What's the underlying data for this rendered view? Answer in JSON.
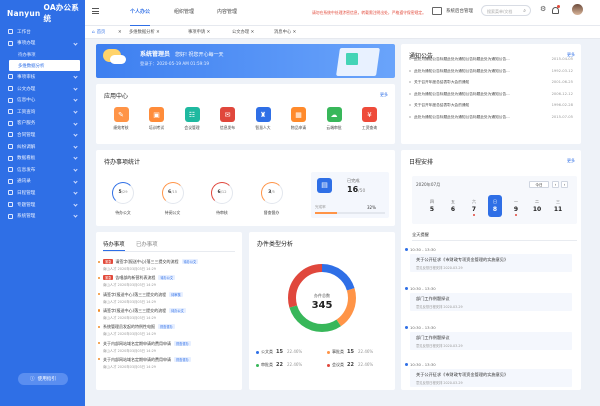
{
  "app": {
    "logo": "Nanyun",
    "title": "OA办公系统"
  },
  "colors": {
    "primary": "#2f6fe6",
    "sidebar": "#2f6fe6",
    "alert": "#e24a3b"
  },
  "sidebar": {
    "items": [
      {
        "icon": "home-icon",
        "label": "工作台"
      },
      {
        "icon": "briefcase-icon",
        "label": "事项办理",
        "expanded": true
      },
      {
        "icon": "user-icon",
        "label": "事项审核"
      },
      {
        "icon": "document-icon",
        "label": "公文办理"
      },
      {
        "icon": "message-icon",
        "label": "信息中心"
      },
      {
        "icon": "box-icon",
        "label": "工资查询"
      },
      {
        "icon": "people-icon",
        "label": "客户服务"
      },
      {
        "icon": "stack-icon",
        "label": "合同管理"
      },
      {
        "icon": "shield-icon",
        "label": "纠纷调解"
      },
      {
        "icon": "chart-icon",
        "label": "数据看板"
      },
      {
        "icon": "doc2-icon",
        "label": "信息发布"
      },
      {
        "icon": "mail-icon",
        "label": "通讯录"
      },
      {
        "icon": "calendar-icon",
        "label": "日程管理"
      },
      {
        "icon": "folder-icon",
        "label": "专题管理"
      },
      {
        "icon": "settings-icon",
        "label": "系统管理"
      }
    ],
    "sub_items": [
      "待办事项",
      "多维数据分析"
    ],
    "bottom_button": "使用指引"
  },
  "topbar": {
    "nav": [
      "个人办公",
      "组织管理",
      "内容管理"
    ],
    "notice": "请勿在系统中处理涉密信息，转载需注明出处，严格遵守保密规定。",
    "backend_label": "系统后台管理",
    "search_placeholder": "搜索菜单/文档"
  },
  "tabs": [
    "首页",
    "多维数据分析",
    "事项申请",
    "公文办理",
    "消息中心"
  ],
  "welcome": {
    "greeting": "系统管理员",
    "motto": "您好! 祝您开心每一天",
    "login_label": "登录于：",
    "login_time": "2020-05-19 AM 01:59:19"
  },
  "notices": {
    "title": "通知公告",
    "more": "更多",
    "items": [
      {
        "text": "此处为通知公告标题此处为通知公告标题此处为通知公告...",
        "date": "2015-04-05"
      },
      {
        "text": "此处为通知公告标题此处为通知公告标题此处为通知公告...",
        "date": "1992-03-12"
      },
      {
        "text": "关于召开年度总结表彰大会的通知",
        "date": "2001-06-25"
      },
      {
        "text": "此处为通知公告标题此处为通知公告标题此处为通知公告...",
        "date": "2006-12-12"
      },
      {
        "text": "关于召开年度总结表彰大会的通知",
        "date": "1996-02-28"
      },
      {
        "text": "此处为通知公告标题此处为通知公告标题此处为通知公告...",
        "date": "2015-07-05"
      }
    ]
  },
  "apps": {
    "title": "应用中心",
    "more": "更多",
    "items": [
      {
        "label": "绩效考核",
        "color": "#ff9447"
      },
      {
        "label": "培训考试",
        "color": "#ff8c3a"
      },
      {
        "label": "会议管理",
        "color": "#1fb9a0"
      },
      {
        "label": "信息发布",
        "color": "#e0473c"
      },
      {
        "label": "智慧人大",
        "color": "#2f6fe6"
      },
      {
        "label": "物品申请",
        "color": "#ff8a2b"
      },
      {
        "label": "云端审批",
        "color": "#38b75a"
      },
      {
        "label": "工资查询",
        "color": "#ee4b3a"
      }
    ]
  },
  "pending_stats": {
    "title": "待办事项统计",
    "items": [
      {
        "value": "5",
        "total": "/29",
        "label": "待办公文"
      },
      {
        "value": "6",
        "total": "/15",
        "label": "待阅公文"
      },
      {
        "value": "6",
        "total": "/12",
        "label": "待审核"
      },
      {
        "value": "3",
        "total": "/5",
        "label": "督查督办"
      }
    ],
    "done_label": "已完成",
    "done_value": "16",
    "done_total": "/50",
    "progress_label": "完成率",
    "progress_pct": "32%",
    "progress_value": 0.32
  },
  "schedule": {
    "title": "日程安排",
    "more": "更多",
    "month": "2020年07月",
    "today_btn": "今日",
    "weekdays": [
      "四",
      "五",
      "六",
      "日",
      "一",
      "二",
      "三"
    ],
    "days": [
      "5",
      "6",
      "7",
      "8",
      "9",
      "10",
      "11"
    ],
    "selected_index": 3,
    "all_day_label": "全天提醒",
    "events": [
      {
        "time": "10:30 - 13:30",
        "title": "关于公开征求《市财政专项资金管理的实施意见》",
        "sub": "意见反馈日程安排 2020-03-29"
      },
      {
        "time": "10:30 - 13:30",
        "title": "部门工作例题探议",
        "sub": "意见反馈日程安排 2020-03-29"
      },
      {
        "time": "10:30 - 13:30",
        "title": "部门工作例题探议",
        "sub": "意见反馈日程安排 2020-03-29"
      },
      {
        "time": "10:30 - 13:30",
        "title": "关于公开征求《市财政专项资金管理的实施意见》",
        "sub": "意见反馈日程安排 2020-03-29"
      }
    ]
  },
  "todo": {
    "tabs": [
      "待办事项",
      "已办事项"
    ],
    "items": [
      {
        "tag": "紧急",
        "title": "请签字(报送中心)落三三提交的流程",
        "status": "待办公文",
        "sub": "南山人才 2020年03月03日 14:29"
      },
      {
        "tag": "紧急",
        "title": "告唱部的新营利表流程",
        "status": "待办公文",
        "sub": "南山人才 2020年03月03日 14:29"
      },
      {
        "tag": "",
        "title": "请签字(报送中心)落三三提交的流程",
        "status": "待审核",
        "sub": "南山人才 2020年03月03日 14:29"
      },
      {
        "tag": "",
        "title": "请签字(报送中心)落三三提交的流程",
        "status": "待办公文",
        "sub": "南山人才 2020年03月03日 14:29"
      },
      {
        "tag": "",
        "title": "系统管理员发起的特例性电报",
        "status": "督查督办",
        "sub": "南山人才 2020年03月03日 14:29"
      },
      {
        "tag": "",
        "title": "关于内部网站域名定期申请的费用申请",
        "status": "督查督办",
        "sub": "南山人才 2020年03月03日 14:29"
      },
      {
        "tag": "",
        "title": "关于内部网站域名定期申请的费用申请",
        "status": "督查督办",
        "sub": "南山人才 2020年03月03日 14:29"
      }
    ]
  },
  "chart_data": {
    "type": "pie",
    "title": "办件类型分析",
    "center_label": "办件总数",
    "total": 345,
    "series": [
      {
        "name": "公文类",
        "value": 15,
        "pct": "22.46%",
        "color": "#2f6fe6"
      },
      {
        "name": "事批类",
        "value": 15,
        "pct": "22.46%",
        "color": "#ff9447"
      },
      {
        "name": "审批类",
        "value": 22,
        "pct": "22.46%",
        "color": "#38b75a"
      },
      {
        "name": "会议类",
        "value": 22,
        "pct": "22.46%",
        "color": "#e0473c"
      }
    ]
  }
}
